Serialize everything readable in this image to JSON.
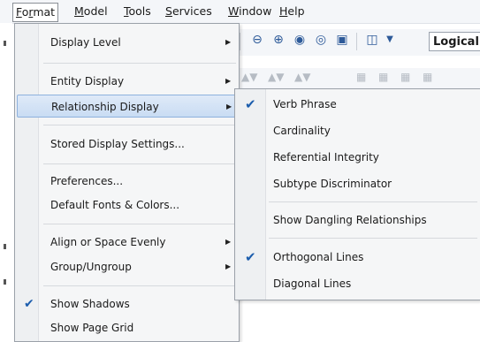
{
  "menubar": {
    "items": [
      "Format",
      "Model",
      "Tools",
      "Services",
      "Window",
      "Help"
    ]
  },
  "toolbar": {
    "view_select_value": "Logical",
    "icons": [
      "zoom-out-icon",
      "zoom-in-icon",
      "zoom-fit-icon",
      "zoom-page-icon",
      "zoom-select-icon",
      "view-icon"
    ]
  },
  "format_menu": {
    "items": [
      {
        "label": "Display Level",
        "submenu": true
      },
      {
        "label": "Entity Display",
        "submenu": true
      },
      {
        "label": "Relationship Display",
        "submenu": true,
        "highlighted": true
      },
      {
        "label": "Stored Display Settings..."
      },
      {
        "label": "Preferences..."
      },
      {
        "label": "Default Fonts & Colors..."
      },
      {
        "label": "Align or Space Evenly",
        "submenu": true
      },
      {
        "label": "Group/Ungroup",
        "submenu": true
      },
      {
        "label": "Show Shadows",
        "checked": true
      },
      {
        "label": "Show Page Grid"
      }
    ]
  },
  "relationship_submenu": {
    "items": [
      {
        "label": "Verb Phrase",
        "checked": true
      },
      {
        "label": "Cardinality"
      },
      {
        "label": "Referential Integrity"
      },
      {
        "label": "Subtype Discriminator"
      },
      {
        "label": "Show Dangling Relationships"
      },
      {
        "label": "Orthogonal Lines",
        "checked": true
      },
      {
        "label": "Diagonal Lines"
      }
    ]
  },
  "colors": {
    "highlight": "#c9dcf3",
    "check": "#1c5dad",
    "toolbar_icon": "#2d5a99"
  }
}
